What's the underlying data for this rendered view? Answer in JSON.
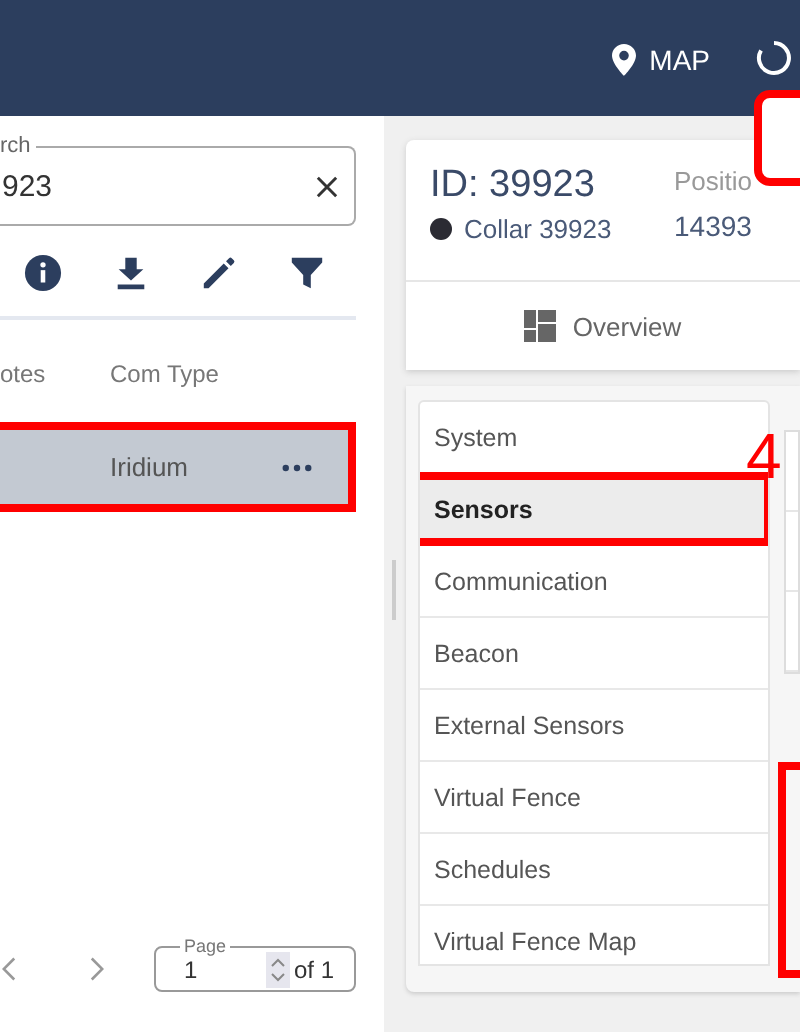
{
  "header": {
    "nav": [
      {
        "label": "MAP"
      }
    ]
  },
  "search": {
    "label": "rch",
    "value": "923"
  },
  "table": {
    "columns": [
      "otes",
      "Com Type"
    ],
    "rows": [
      {
        "com_type": "Iridium",
        "selected": true,
        "highlighted": true
      }
    ]
  },
  "pagination": {
    "label": "Page",
    "value": "1",
    "total": "of 1"
  },
  "device": {
    "id": "ID: 39923",
    "name": "Collar 39923",
    "color": "#2b2b33",
    "position_label": "Positio",
    "position_value": "14393"
  },
  "tabs": [
    {
      "label": "Overview"
    }
  ],
  "annotation": {
    "step": "4"
  },
  "menu": [
    {
      "label": "System",
      "selected": false,
      "highlighted": false
    },
    {
      "label": "Sensors",
      "selected": true,
      "highlighted": true
    },
    {
      "label": "Communication",
      "selected": false,
      "highlighted": false
    },
    {
      "label": "Beacon",
      "selected": false,
      "highlighted": false
    },
    {
      "label": "External Sensors",
      "selected": false,
      "highlighted": false
    },
    {
      "label": "Virtual Fence",
      "selected": false,
      "highlighted": false
    },
    {
      "label": "Schedules",
      "selected": false,
      "highlighted": false
    },
    {
      "label": "Virtual Fence Map",
      "selected": false,
      "highlighted": false
    }
  ]
}
